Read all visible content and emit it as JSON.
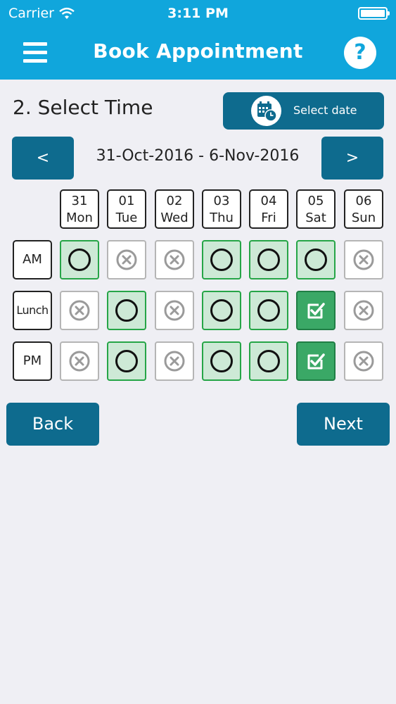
{
  "status": {
    "carrier": "Carrier",
    "time": "3:11 PM"
  },
  "nav": {
    "title": "Book Appointment",
    "help": "?"
  },
  "section": {
    "title": "2. Select Time",
    "select_date_label": "Select date"
  },
  "week": {
    "prev": "<",
    "next": ">",
    "range": "31-Oct-2016 - 6-Nov-2016"
  },
  "days": [
    {
      "num": "31",
      "name": "Mon"
    },
    {
      "num": "01",
      "name": "Tue"
    },
    {
      "num": "02",
      "name": "Wed"
    },
    {
      "num": "03",
      "name": "Thu"
    },
    {
      "num": "04",
      "name": "Fri"
    },
    {
      "num": "05",
      "name": "Sat"
    },
    {
      "num": "06",
      "name": "Sun"
    }
  ],
  "rows": [
    {
      "label": "AM",
      "slots": [
        "available",
        "unavailable",
        "unavailable",
        "available",
        "available",
        "available",
        "unavailable"
      ]
    },
    {
      "label": "Lunch",
      "slots": [
        "unavailable",
        "available",
        "unavailable",
        "available",
        "available",
        "selected",
        "unavailable"
      ]
    },
    {
      "label": "PM",
      "slots": [
        "unavailable",
        "available",
        "unavailable",
        "available",
        "available",
        "selected",
        "unavailable"
      ]
    }
  ],
  "footer": {
    "back": "Back",
    "next": "Next"
  },
  "colors": {
    "header": "#10a6dc",
    "button": "#0e6b8e",
    "available": "#cde9d6",
    "selected": "#3aa866",
    "background": "#efeff4"
  }
}
